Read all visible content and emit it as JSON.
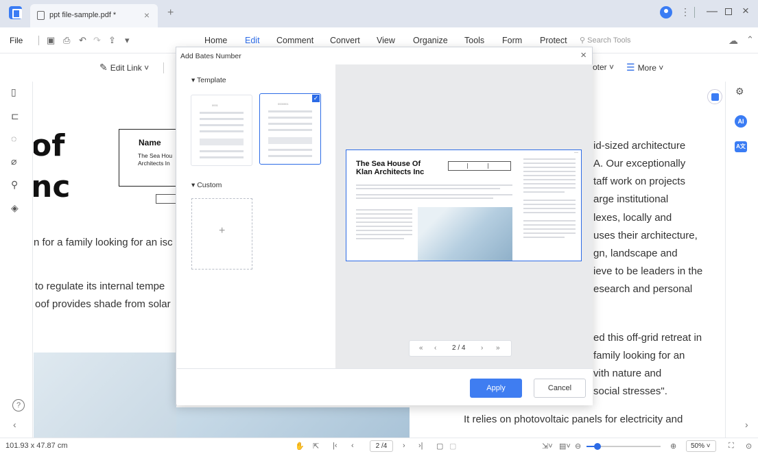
{
  "titlebar": {
    "tab_title": "ppt file-sample.pdf *",
    "tab_close": "×",
    "new_tab": "+"
  },
  "menu": {
    "file": "File",
    "items": [
      "Home",
      "Edit",
      "Comment",
      "Convert",
      "View",
      "Organize",
      "Tools",
      "Form",
      "Protect"
    ],
    "active": "Edit",
    "search_placeholder": "Search Tools"
  },
  "toolbar": {
    "edit_link": "Edit Link",
    "footer": "oter",
    "more": "More"
  },
  "document": {
    "big_text_1": "of",
    "big_text_2": "nc",
    "name_label": "Name",
    "name_line_1": "The Sea Hou",
    "name_line_2": "Architects In",
    "left_lines": [
      "n for a family looking for an isc",
      "to regulate its internal tempe",
      "oof provides shade from solar"
    ],
    "right_lines": [
      "id-sized architecture",
      "A. Our exceptionally",
      "taff work on projects",
      "arge institutional",
      "lexes, locally and",
      "uses their architecture,",
      "gn, landscape and",
      "ieve to be leaders in the",
      "esearch and personal",
      "ed this off-grid retreat in",
      "family looking for an",
      "vith nature and",
      "social stresses\"."
    ],
    "bottom_line": "It relies on photovoltaic panels for electricity and"
  },
  "modal": {
    "title": "Add Bates Number",
    "template_label": "Template",
    "custom_label": "Custom",
    "plus": "+",
    "preview": {
      "title_line_1": "The Sea House Of",
      "title_line_2": "Klan Architects Inc",
      "page_indicator": "2 / 4",
      "first": "«",
      "prev": "‹",
      "next": "›",
      "last": "»"
    },
    "apply": "Apply",
    "cancel": "Cancel"
  },
  "statusbar": {
    "dimensions": "101.93 x 47.87 cm",
    "page": "2 /4",
    "zoom": "50%",
    "zoom_level": 0.5
  }
}
